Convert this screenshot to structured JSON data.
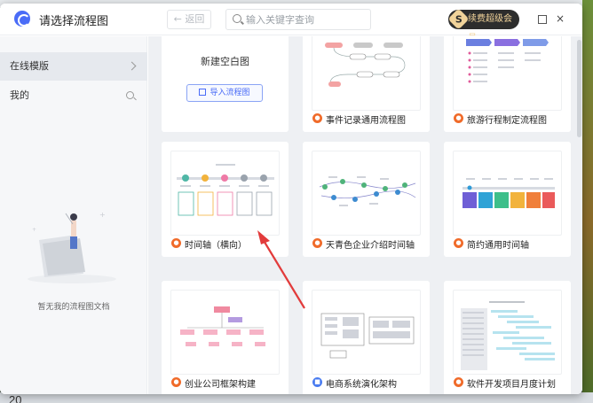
{
  "titlebar": {
    "title": "请选择流程图",
    "back_label": "← 返回",
    "search_placeholder": "输入关键字查询",
    "vip_label": "续费超级会员",
    "vip_icon": "S",
    "close_glyph": "×"
  },
  "sidebar": {
    "online_templates": "在线模版",
    "mine": "我的",
    "empty_text": "暂无我的流程图文档"
  },
  "blank": {
    "plus": "+",
    "title": "新建空白图",
    "import_label": "导入流程图"
  },
  "templates": [
    {
      "label": "事件记录通用流程图",
      "icon": "fire-icon"
    },
    {
      "label": "旅游行程制定流程图",
      "icon": "fire-icon"
    },
    {
      "label": "时间轴（横向）",
      "icon": "fire-icon"
    },
    {
      "label": "天青色企业介绍时间轴",
      "icon": "fire-icon"
    },
    {
      "label": "简约通用时间轴",
      "icon": "fire-icon"
    },
    {
      "label": "创业公司框架构建",
      "icon": "fire-icon"
    },
    {
      "label": "电商系统演化架构",
      "icon": "doc-icon"
    },
    {
      "label": "软件开发项目月度计划",
      "icon": "fire-icon"
    }
  ],
  "background": {
    "page_number": "20"
  },
  "colors": {
    "accent": "#4a6cf7",
    "hot_icon": "#f06b2a",
    "annotation_arrow": "#e23b3b"
  }
}
